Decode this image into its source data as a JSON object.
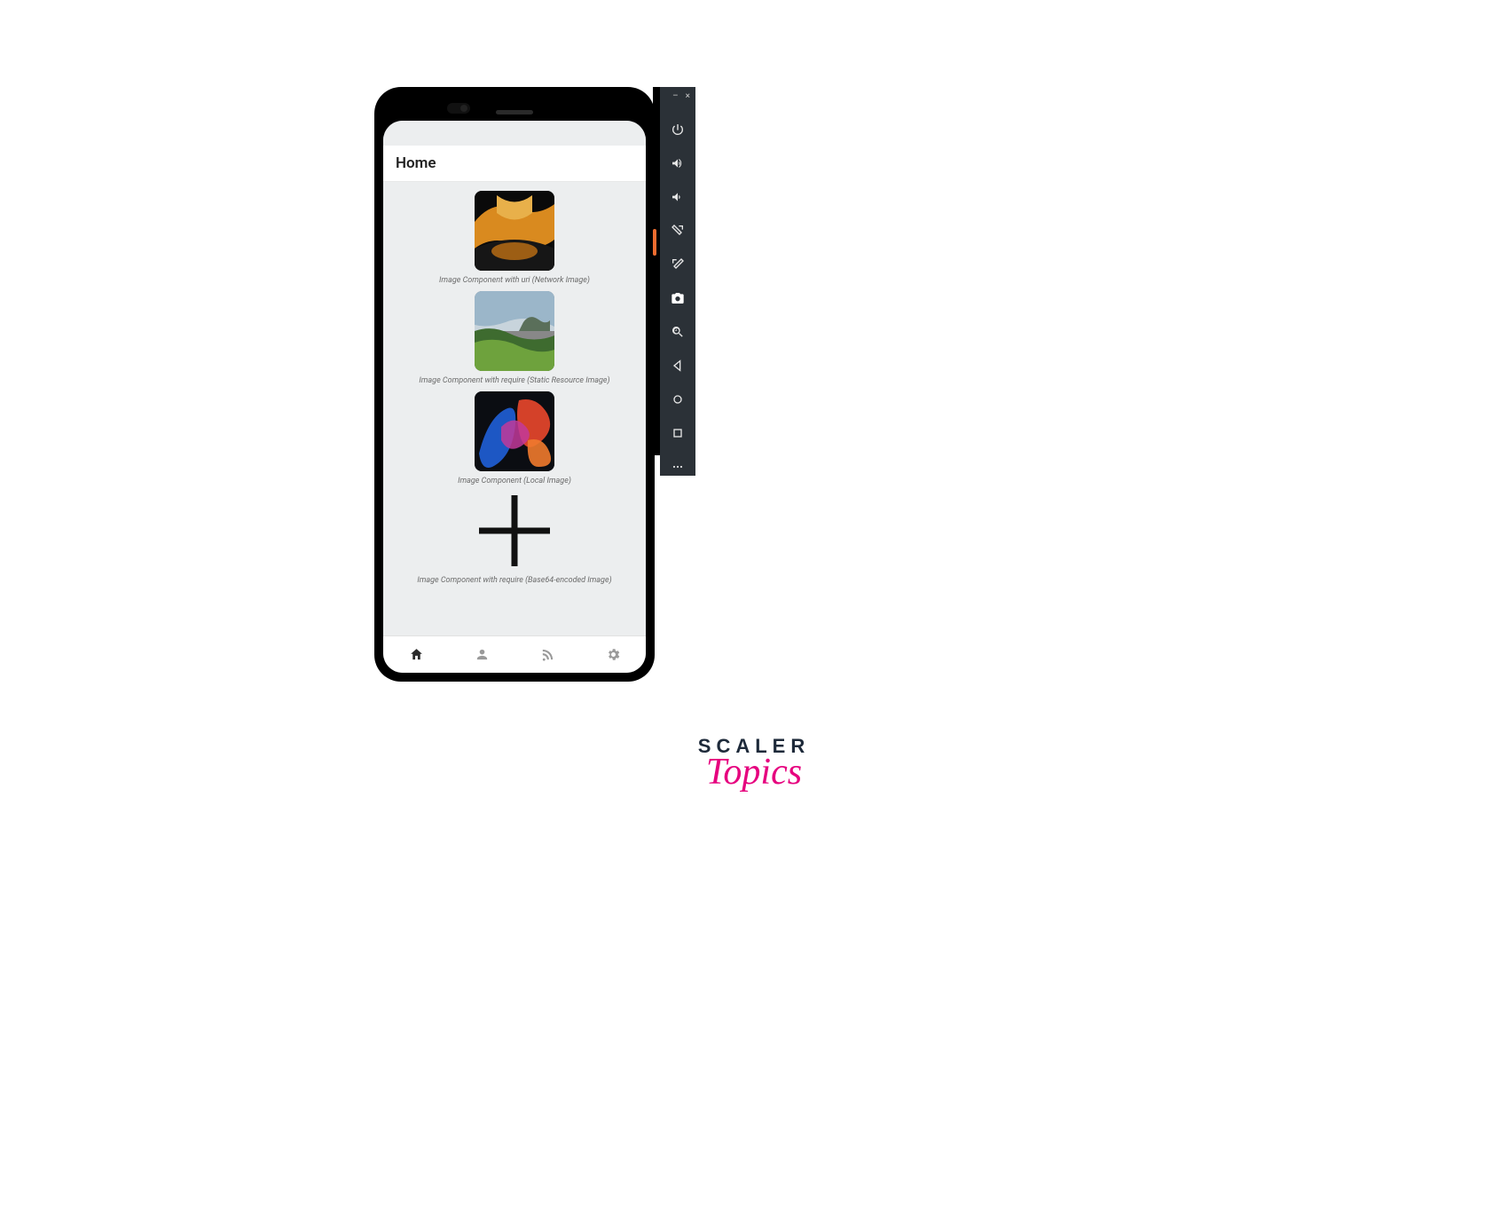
{
  "app": {
    "header_title": "Home",
    "images": [
      {
        "caption": "Image Component with uri (Network Image)"
      },
      {
        "caption": "Image Component with require (Static Resource Image)"
      },
      {
        "caption": "Image Component (Local Image)"
      },
      {
        "caption": "Image Component with require (Base64-encoded Image)"
      }
    ],
    "tabs": [
      {
        "name": "home",
        "active": true
      },
      {
        "name": "profile",
        "active": false
      },
      {
        "name": "feed",
        "active": false
      },
      {
        "name": "settings",
        "active": false
      }
    ]
  },
  "emulator_toolbar": {
    "window_controls": {
      "minimize": "–",
      "close": "×"
    },
    "tools": [
      "power",
      "volume-up",
      "volume-down",
      "rotate-left",
      "rotate-right",
      "camera",
      "zoom",
      "back",
      "home",
      "overview",
      "more"
    ]
  },
  "brand": {
    "word1": "SCALER",
    "word2": "Topics"
  }
}
